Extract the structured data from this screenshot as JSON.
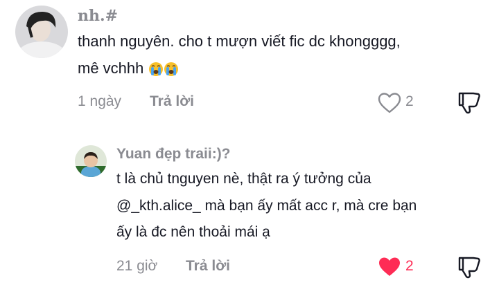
{
  "comment": {
    "username": "nh.#",
    "lines": [
      "thanh nguyên. cho t mượn viết fic dc khongggg,",
      "mê vchhh"
    ],
    "emojis": [
      "loudly-crying-face",
      "loudly-crying-face"
    ],
    "time": "1 ngày",
    "reply_label": "Trả lời",
    "likes": "2",
    "liked": false
  },
  "reply": {
    "username": "Yuan đẹp traii:)?",
    "lines": [
      "t là chủ tnguyen nè, thật ra ý tưởng của",
      "@_kth.alice_ mà bạn ấy mất acc r, mà cre bạn",
      "ấy là đc nên thoải mái ạ"
    ],
    "time": "21 giờ",
    "reply_label": "Trả lời",
    "likes": "2",
    "liked": true
  },
  "colors": {
    "text": "#161823",
    "muted": "#8a8b91",
    "like_active": "#fe2c55"
  },
  "icons": [
    "heart-outline-icon",
    "heart-filled-icon",
    "dislike-icon"
  ]
}
